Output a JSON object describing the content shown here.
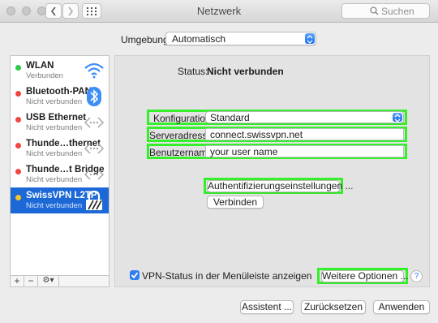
{
  "window": {
    "title": "Netzwerk"
  },
  "toolbar": {
    "search_placeholder": "Suchen"
  },
  "location": {
    "label": "Umgebung:",
    "value": "Automatisch"
  },
  "services": [
    {
      "name": "WLAN",
      "status": "Verbunden",
      "dot": "#2ec94b",
      "icon": "wifi-icon"
    },
    {
      "name": "Bluetooth-PAN",
      "status": "Nicht verbunden",
      "dot": "#f0463f",
      "icon": "bluetooth-icon"
    },
    {
      "name": "USB Ethernet",
      "status": "Nicht verbunden",
      "dot": "#f0463f",
      "icon": "ethernet-arrows-icon"
    },
    {
      "name": "Thunde…thernet",
      "status": "Nicht verbunden",
      "dot": "#f0463f",
      "icon": "ethernet-arrows-icon"
    },
    {
      "name": "Thunde…t Bridge",
      "status": "Nicht verbunden",
      "dot": "#f0463f",
      "icon": "ethernet-arrows-icon"
    },
    {
      "name": "SwissVPN L2TP",
      "status": "Nicht verbunden",
      "dot": "#f5c52c",
      "icon": "vpn-lock-icon",
      "selected": true
    }
  ],
  "sidebar_controls": {
    "add": "+",
    "remove": "−",
    "actions": "⚙▾"
  },
  "detail": {
    "status_label": "Status:",
    "status_value": "Nicht verbunden",
    "config_label": "Konfiguration:",
    "config_value": "Standard",
    "server_label": "Serveradresse:",
    "server_value": "connect.swissvpn.net",
    "user_label": "Benutzername:",
    "user_value": "your user name",
    "auth_button": "Authentifizierungseinstellungen ...",
    "connect_button": "Verbinden",
    "menubar_checkbox": "VPN-Status in der Menüleiste anzeigen",
    "advanced_button": "Weitere Optionen ...",
    "help": "?"
  },
  "footer": {
    "assistant": "Assistent ...",
    "revert": "Zurücksetzen",
    "apply": "Anwenden"
  },
  "colors": {
    "highlight": "#35ef2a",
    "selection": "#1b68d6",
    "accent": "#2f7ff3"
  }
}
